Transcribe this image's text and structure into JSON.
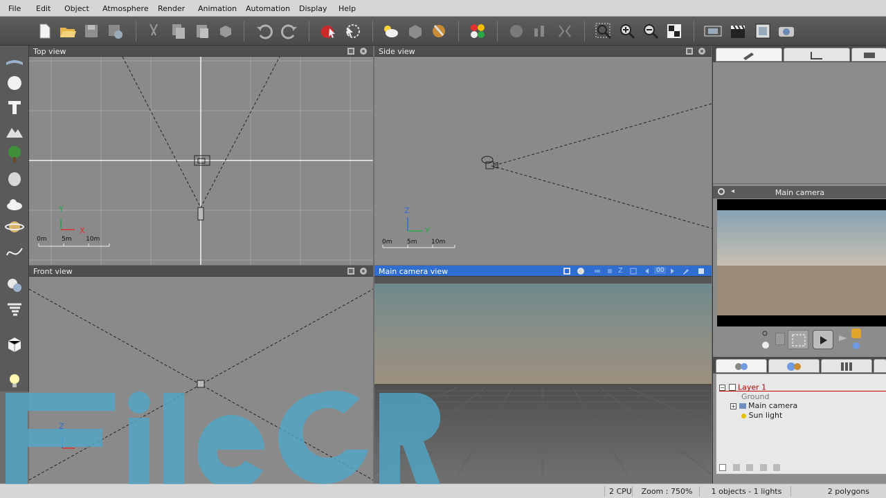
{
  "menu": [
    "File",
    "Edit",
    "Object",
    "Atmosphere",
    "Render",
    "Animation",
    "Automation",
    "Display",
    "Help"
  ],
  "viewports": {
    "top": {
      "title": "Top view",
      "scale": [
        "0m",
        "5m",
        "10m"
      ],
      "axes": [
        "Y",
        "X"
      ]
    },
    "side": {
      "title": "Side view",
      "scale": [
        "0m",
        "5m",
        "10m"
      ],
      "axes": [
        "Z",
        "Y"
      ]
    },
    "front": {
      "title": "Front view",
      "axes": [
        "Z"
      ]
    },
    "camera": {
      "title": "Main camera view"
    }
  },
  "camera_toolbar": {
    "zoom_value": "00"
  },
  "right_panel": {
    "preview_title": "Main camera",
    "tree": {
      "layer": "Layer 1",
      "items": [
        "Ground",
        "Main camera",
        "Sun light"
      ]
    }
  },
  "status": {
    "cpu": "2 CPU",
    "zoom": "Zoom : 750%",
    "objects": "1 objects - 1 lights",
    "polygons": "2 polygons"
  },
  "watermark": "FileCR",
  "colors": {
    "active_title": "#2f6ecf",
    "layer_text": "#c00000"
  }
}
